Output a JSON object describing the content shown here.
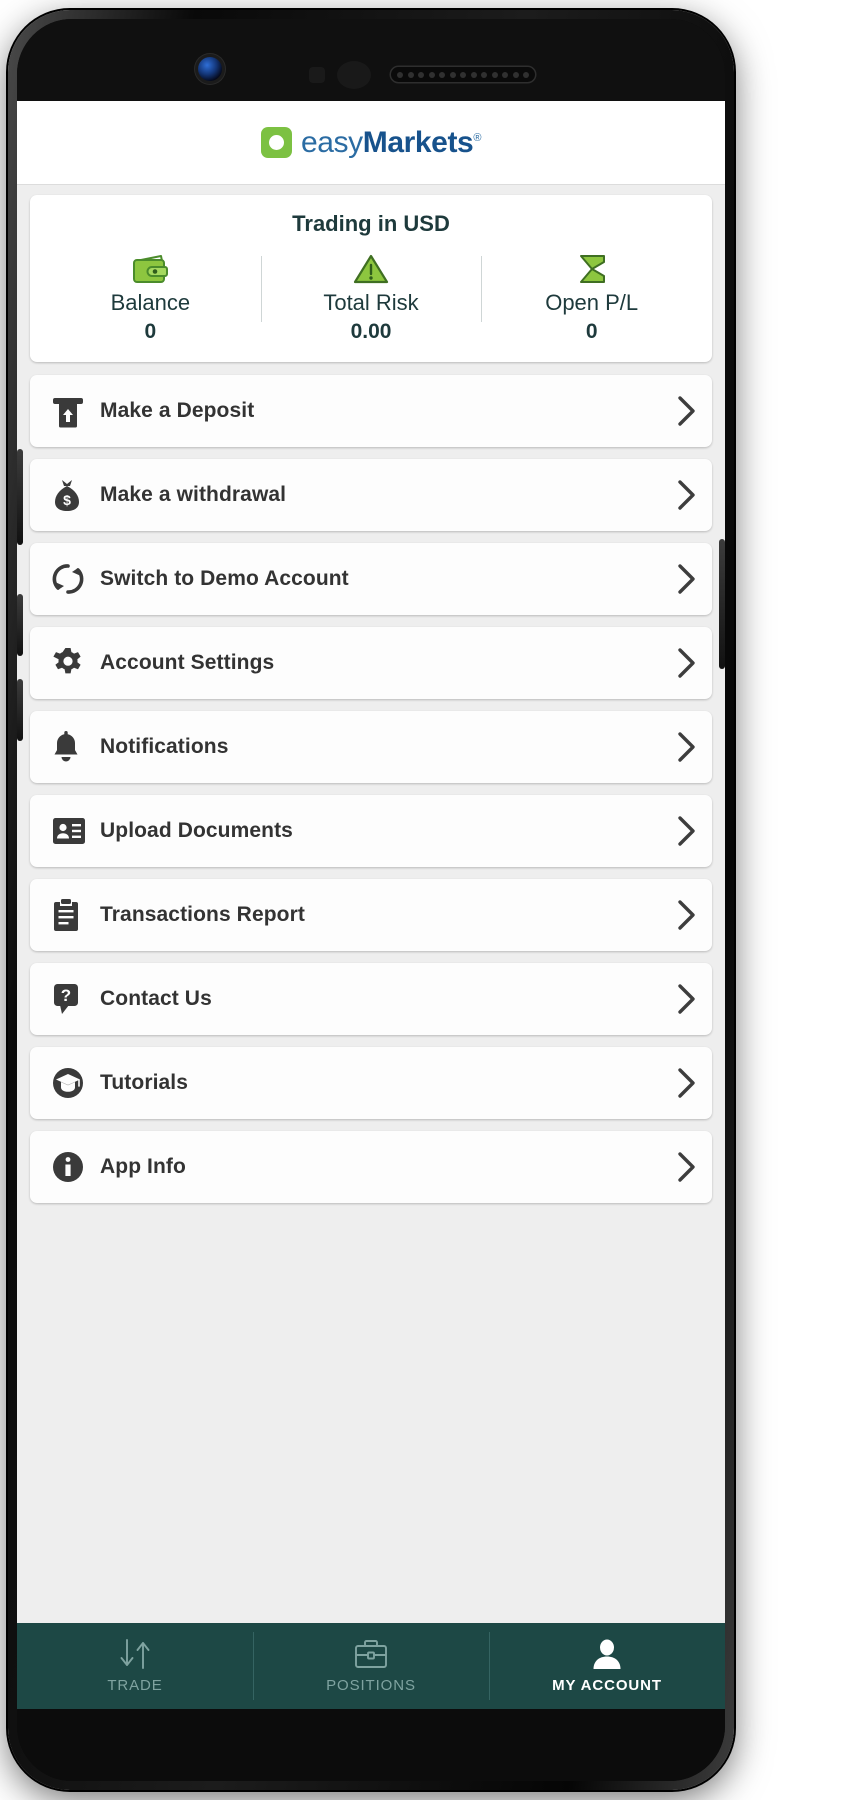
{
  "device": {
    "hardware": {
      "camera": "front-camera",
      "speaker": "earpiece-speaker"
    }
  },
  "header": {
    "logo": {
      "mark_color": "#7cc142",
      "text_primary": "easy",
      "text_secondary": "Markets",
      "registered_mark": "®",
      "primary_color": "#2b6ca3",
      "secondary_color": "#17528c"
    }
  },
  "summary": {
    "title": "Trading in USD",
    "accent_color": "#8dc63f",
    "metrics": [
      {
        "icon": "wallet-icon",
        "label": "Balance",
        "value": "0"
      },
      {
        "icon": "warning-triangle-icon",
        "label": "Total Risk",
        "value": "0.00"
      },
      {
        "icon": "sigma-sum-icon",
        "label": "Open P/L",
        "value": "0"
      }
    ]
  },
  "menu": {
    "items": [
      {
        "icon": "deposit-atm-icon",
        "label": "Make a Deposit"
      },
      {
        "icon": "money-bag-icon",
        "label": "Make a withdrawal"
      },
      {
        "icon": "switch-account-icon",
        "label": "Switch to Demo Account"
      },
      {
        "icon": "gear-icon",
        "label": "Account Settings"
      },
      {
        "icon": "bell-icon",
        "label": "Notifications"
      },
      {
        "icon": "id-card-icon",
        "label": "Upload Documents"
      },
      {
        "icon": "clipboard-icon",
        "label": "Transactions Report"
      },
      {
        "icon": "question-bubble-icon",
        "label": "Contact Us"
      },
      {
        "icon": "graduation-cap-icon",
        "label": "Tutorials"
      },
      {
        "icon": "info-circle-icon",
        "label": "App Info"
      }
    ],
    "chevron": "chevron-right-icon"
  },
  "tabbar": {
    "background_color": "#1d4845",
    "active_color": "#ffffff",
    "inactive_color": "#7fa3a0",
    "tabs": [
      {
        "icon": "arrows-down-up-icon",
        "label": "TRADE",
        "active": false
      },
      {
        "icon": "briefcase-icon",
        "label": "POSITIONS",
        "active": false
      },
      {
        "icon": "person-icon",
        "label": "MY ACCOUNT",
        "active": true
      }
    ]
  }
}
